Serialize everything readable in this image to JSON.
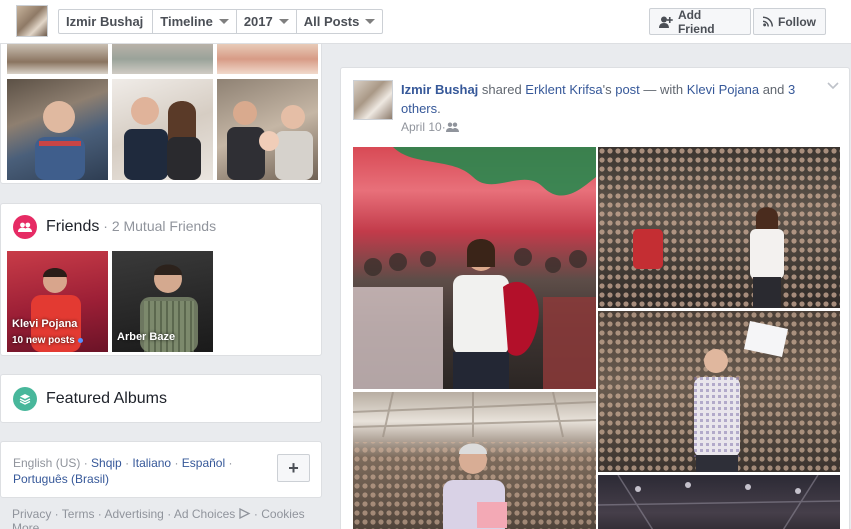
{
  "topbar": {
    "nav": {
      "name": "Izmir Bushaj",
      "timeline": "Timeline",
      "year": "2017",
      "filter": "All Posts"
    },
    "add_friend": "Add Friend",
    "follow": "Follow"
  },
  "friends": {
    "title": "Friends",
    "separator": " · ",
    "mutual": "2 Mutual Friends",
    "items": [
      {
        "name": "Klevi Pojana",
        "status": "10 new posts"
      },
      {
        "name": "Arber Baze",
        "status": ""
      }
    ]
  },
  "featured": {
    "title": "Featured Albums"
  },
  "languages": {
    "current": "English (US)",
    "others": [
      "Shqip",
      "Italiano",
      "Español",
      "Português (Brasil)"
    ],
    "add_label": "+"
  },
  "footer": {
    "links": [
      "Privacy",
      "Terms",
      "Advertising",
      "Ad Choices",
      "Cookies",
      "More"
    ]
  },
  "post": {
    "author": "Izmir Bushaj",
    "action": "shared",
    "shared_from": "Erklent Krifsa",
    "possessive": "'s",
    "object": "post",
    "dash_with": "— with",
    "tagged": "Klevi Pojana",
    "and": "and",
    "others": "3 others",
    "period": ".",
    "date": "April 10",
    "dot": " · "
  },
  "icons": {
    "friends": "friends-icon",
    "albums": "albums-icon",
    "add_friend": "add-friend-icon",
    "follow": "rss-icon",
    "audience": "friends-audience-icon",
    "chevron": "chevron-down-icon",
    "ad_choices": "ad-choices-icon"
  },
  "colors": {
    "link": "#365899",
    "friends_icon_bg": "#e62b64",
    "albums_icon_bg": "#48b79b"
  }
}
